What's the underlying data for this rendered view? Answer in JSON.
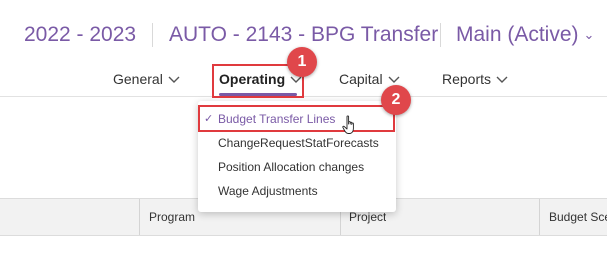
{
  "header": {
    "year": "2022 - 2023",
    "name": "AUTO - 2143 - BPG Transfer",
    "version": "Main (Active)"
  },
  "nav": {
    "items": [
      {
        "label": "General"
      },
      {
        "label": "Operating"
      },
      {
        "label": "Capital"
      },
      {
        "label": "Reports"
      }
    ],
    "active": "Operating"
  },
  "dropdown": {
    "items": [
      {
        "label": "Budget Transfer Lines",
        "selected": true
      },
      {
        "label": "ChangeRequestStatForecasts",
        "selected": false
      },
      {
        "label": "Position Allocation changes",
        "selected": false
      },
      {
        "label": "Wage Adjustments",
        "selected": false
      }
    ]
  },
  "table": {
    "columns": [
      "",
      "Program",
      "Project",
      "Budget Sce"
    ]
  },
  "annotations": {
    "step1": "1",
    "step2": "2"
  },
  "colors": {
    "accent": "#7a5aa6",
    "highlight": "#e03a3e"
  }
}
